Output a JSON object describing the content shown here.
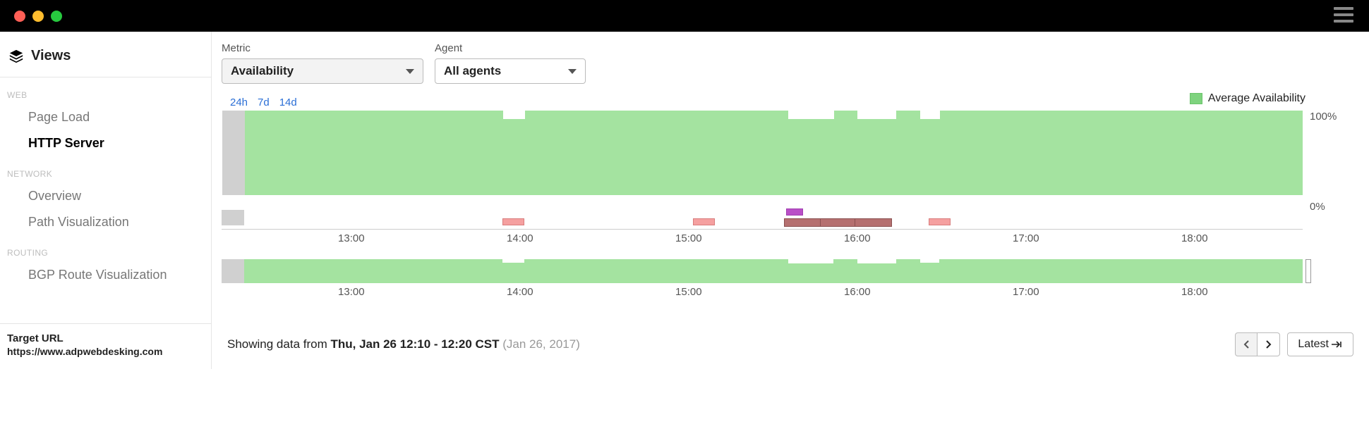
{
  "titlebar": {},
  "sidebar": {
    "views_label": "Views",
    "sections": [
      {
        "label": "WEB",
        "items": [
          "Page Load",
          "HTTP Server"
        ],
        "active": 1
      },
      {
        "label": "NETWORK",
        "items": [
          "Overview",
          "Path Visualization"
        ],
        "active": -1
      },
      {
        "label": "ROUTING",
        "items": [
          "BGP Route Visualization"
        ],
        "active": -1
      }
    ],
    "target_label": "Target URL",
    "target_url": "https://www.adpwebdesking.com"
  },
  "controls": {
    "metric_label": "Metric",
    "metric_value": "Availability",
    "agent_label": "Agent",
    "agent_value": "All agents"
  },
  "legend": {
    "label": "Average Availability"
  },
  "time_tabs": [
    "24h",
    "7d",
    "14d"
  ],
  "y_axis": {
    "top": "100%",
    "bottom": "0%"
  },
  "time_axis": [
    "13:00",
    "14:00",
    "15:00",
    "16:00",
    "17:00",
    "18:00"
  ],
  "footer": {
    "prefix": "Showing data from ",
    "bold": "Thu, Jan 26 12:10 - 12:20 CST ",
    "grey": "(Jan 26, 2017)",
    "latest": "Latest"
  },
  "chart_data": {
    "type": "area",
    "title": "Average Availability",
    "ylabel": "Availability",
    "ylim": [
      0,
      100
    ],
    "x_ticks": [
      "13:00",
      "14:00",
      "15:00",
      "16:00",
      "17:00",
      "18:00"
    ],
    "series": [
      {
        "name": "Average Availability",
        "segments": [
          {
            "from_pct": 2.2,
            "to_pct": 100,
            "value": 100
          }
        ],
        "dips": [
          {
            "at_pct": 26.0,
            "width_pct": 2.0,
            "value_drop_to": 90
          },
          {
            "at_pct": 52.4,
            "width_pct": 4.2,
            "value_drop_to": 88
          },
          {
            "at_pct": 58.8,
            "width_pct": 3.6,
            "value_drop_to": 88
          },
          {
            "at_pct": 64.6,
            "width_pct": 1.8,
            "value_drop_to": 90
          }
        ]
      }
    ],
    "event_markers": {
      "purple": [
        {
          "at_pct": 52.2,
          "width_pct": 1.6
        }
      ],
      "light_red": [
        {
          "at_pct": 26.0,
          "width_pct": 2.0
        },
        {
          "at_pct": 43.6,
          "width_pct": 2.0
        },
        {
          "at_pct": 65.4,
          "width_pct": 2.0
        }
      ],
      "dark_red": [
        {
          "at_pct": 52.0,
          "width_pct": 10.0
        }
      ]
    }
  }
}
